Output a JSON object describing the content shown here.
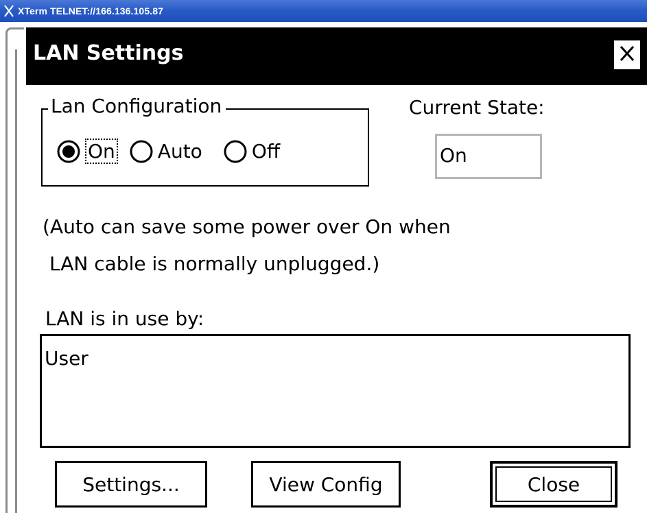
{
  "window": {
    "title": "XTerm TELNET://166.136.105.87",
    "icon": "x-logo-icon"
  },
  "dialog": {
    "title": "LAN Settings",
    "close_icon": "close-icon"
  },
  "lan_configuration": {
    "legend": "Lan Configuration",
    "options": [
      {
        "label": "On",
        "selected": true
      },
      {
        "label": "Auto",
        "selected": false
      },
      {
        "label": "Off",
        "selected": false
      }
    ]
  },
  "current_state": {
    "label": "Current State:",
    "value": "On"
  },
  "info": {
    "line1": "(Auto can save some power over On when",
    "line2": "LAN cable is normally unplugged.)"
  },
  "in_use": {
    "label": "LAN is in use by:",
    "items": [
      "User"
    ]
  },
  "buttons": {
    "settings": "Settings...",
    "view_config": "View Config",
    "close": "Close"
  },
  "colors": {
    "titlebar": "#2a5cc8",
    "dialog_title_bg": "#000000",
    "state_box_border": "#b5b5b5"
  }
}
